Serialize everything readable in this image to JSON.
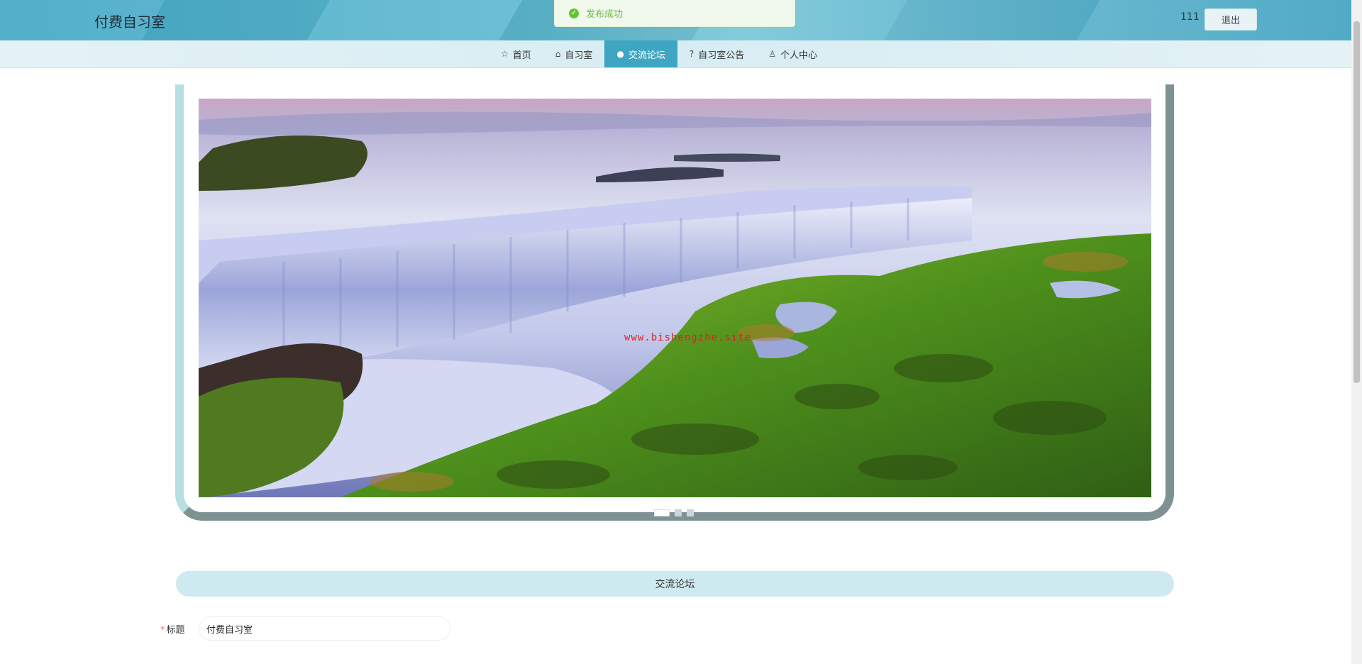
{
  "app": {
    "title": "付费自习室"
  },
  "header": {
    "username": "111",
    "logout_label": "退出"
  },
  "toast": {
    "message": "发布成功",
    "icon": "check-circle-icon"
  },
  "nav": {
    "items": [
      {
        "label": "首页",
        "icon": "☆"
      },
      {
        "label": "自习室",
        "icon": "⌂"
      },
      {
        "label": "交流论坛",
        "icon": "●",
        "active": true
      },
      {
        "label": "自习室公告",
        "icon": "?"
      },
      {
        "label": "个人中心",
        "icon": "♙"
      }
    ]
  },
  "carousel": {
    "watermark": "www.bishengzhe.site",
    "slides_count": 3,
    "active_index": 0,
    "prev_icon": "‹",
    "next_icon": "›"
  },
  "section": {
    "title": "交流论坛"
  },
  "form": {
    "title_label": "标题",
    "required_mark": "*",
    "title_value": "付费自习室"
  }
}
